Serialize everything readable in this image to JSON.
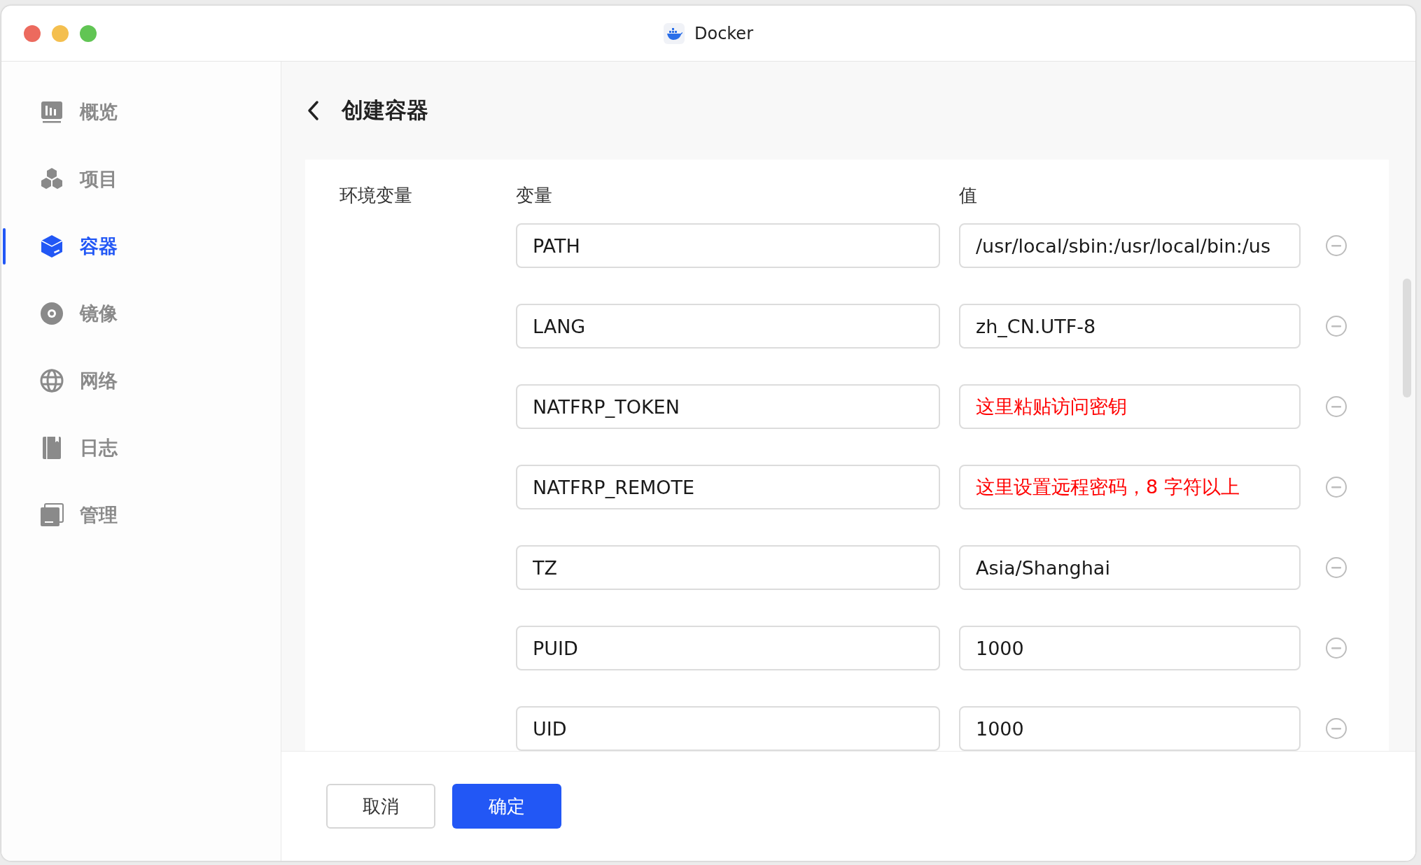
{
  "window": {
    "title": "Docker"
  },
  "sidebar": {
    "items": [
      {
        "label": "概览",
        "selected": false
      },
      {
        "label": "项目",
        "selected": false
      },
      {
        "label": "容器",
        "selected": true
      },
      {
        "label": "镜像",
        "selected": false
      },
      {
        "label": "网络",
        "selected": false
      },
      {
        "label": "日志",
        "selected": false
      },
      {
        "label": "管理",
        "selected": false
      }
    ]
  },
  "page": {
    "title": "创建容器"
  },
  "env": {
    "label": "环境变量",
    "columns": [
      "变量",
      "值"
    ],
    "rows": [
      {
        "name": "PATH",
        "value": "/usr/local/sbin:/usr/local/bin:/us",
        "color": "#1a1a1a"
      },
      {
        "name": "LANG",
        "value": "zh_CN.UTF-8",
        "color": "#1a1a1a"
      },
      {
        "name": "NATFRP_TOKEN",
        "value": "这里粘贴访问密钥",
        "color": "#ff0000"
      },
      {
        "name": "NATFRP_REMOTE",
        "value": "这里设置远程密码，8 字符以上",
        "color": "#ff0000"
      },
      {
        "name": "TZ",
        "value": "Asia/Shanghai",
        "color": "#1a1a1a"
      },
      {
        "name": "PUID",
        "value": "1000",
        "color": "#1a1a1a"
      },
      {
        "name": "UID",
        "value": "1000",
        "color": "#1a1a1a"
      }
    ]
  },
  "footer": {
    "buttons": [
      {
        "label": "取消",
        "kind": "secondary"
      },
      {
        "label": "确定",
        "kind": "primary"
      }
    ]
  }
}
